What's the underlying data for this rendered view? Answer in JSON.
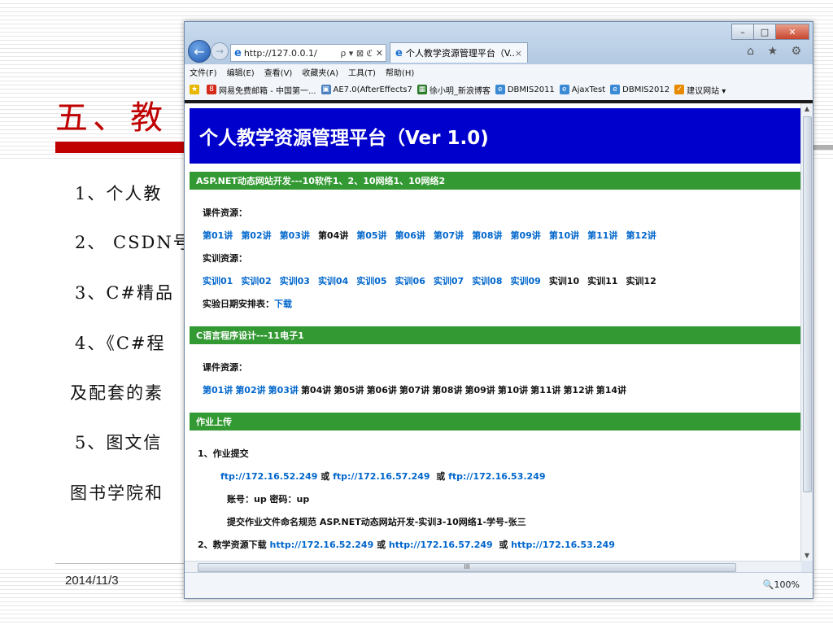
{
  "slide": {
    "title": "五、教",
    "lines": [
      "1、个人教",
      "2、 CSDN号",
      "3、C#精品",
      "4、《C#程",
      "及配套的素",
      "5、图文信",
      "图书学院和"
    ],
    "date": "2014/11/3"
  },
  "browser": {
    "address_url": "http://127.0.0.1/",
    "address_controls": "ρ ▾ ⊠ ℭ ✕",
    "tab_title": "个人教学资源管理平台（V...",
    "tab_close": "×",
    "toolbar_icons": "⌂ ★ ⚙",
    "window_controls": {
      "minimize": "–",
      "maximize": "□",
      "close": "✕"
    },
    "menu": [
      "文件(F)",
      "编辑(E)",
      "查看(V)",
      "收藏夹(A)",
      "工具(T)",
      "帮助(H)"
    ],
    "favorites": [
      "网易免费邮箱 - 中国第一...",
      "AE7.0(AfterEffects7",
      "徐小明_新浪博客",
      "DBMIS2011",
      "AjaxTest",
      "DBMIS2012",
      "建议网站 ▾"
    ],
    "zoom": "🔍100%",
    "hscroll_label": "III"
  },
  "page": {
    "header": "个人教学资源管理平台（Ver 1.0)",
    "section1": {
      "title": "ASP.NET动态网站开发---10软件1、2、10网络1、10网络2",
      "course_label": "课件资源：",
      "lectures": [
        {
          "t": "第01讲",
          "link": true
        },
        {
          "t": "第02讲",
          "link": true
        },
        {
          "t": "第03讲",
          "link": true
        },
        {
          "t": "第04讲",
          "link": false
        },
        {
          "t": "第05讲",
          "link": true
        },
        {
          "t": "第06讲",
          "link": true
        },
        {
          "t": "第07讲",
          "link": true
        },
        {
          "t": "第08讲",
          "link": true
        },
        {
          "t": "第09讲",
          "link": true
        },
        {
          "t": "第10讲",
          "link": true
        },
        {
          "t": "第11讲",
          "link": true
        },
        {
          "t": "第12讲",
          "link": true
        }
      ],
      "training_label": "实训资源：",
      "trainings": [
        {
          "t": "实训01",
          "link": true
        },
        {
          "t": "实训02",
          "link": true
        },
        {
          "t": "实训03",
          "link": true
        },
        {
          "t": "实训04",
          "link": true
        },
        {
          "t": "实训05",
          "link": true
        },
        {
          "t": "实训06",
          "link": true
        },
        {
          "t": "实训07",
          "link": true
        },
        {
          "t": "实训08",
          "link": true
        },
        {
          "t": "实训09",
          "link": true
        },
        {
          "t": "实训10",
          "link": false
        },
        {
          "t": "实训11",
          "link": false
        },
        {
          "t": "实训12",
          "link": false
        }
      ],
      "schedule_label": "实验日期安排表：",
      "schedule_link": "下载"
    },
    "section2": {
      "title": "C语言程序设计---11电子1",
      "course_label": "课件资源：",
      "lectures": [
        {
          "t": "第01讲",
          "link": true
        },
        {
          "t": "第02讲",
          "link": true
        },
        {
          "t": "第03讲",
          "link": true
        },
        {
          "t": "第04讲",
          "link": false
        },
        {
          "t": "第05讲",
          "link": false
        },
        {
          "t": "第06讲",
          "link": false
        },
        {
          "t": "第07讲",
          "link": false
        },
        {
          "t": "第08讲",
          "link": false
        },
        {
          "t": "第09讲",
          "link": false
        },
        {
          "t": "第10讲",
          "link": false
        },
        {
          "t": "第11讲",
          "link": false
        },
        {
          "t": "第12讲",
          "link": false
        },
        {
          "t": "第14讲",
          "link": false
        }
      ]
    },
    "section3": {
      "title": "作业上传",
      "item1": "1、作业提交",
      "ftp1": "ftp://172.16.52.249",
      "or1": "或",
      "ftp2": "ftp://172.16.57.249",
      "or2": "或",
      "ftp3": "ftp://172.16.53.249",
      "account": "账号：up 密码：up",
      "naming": "提交作业文件命名规范 ASP.NET动态网站开发-实训3-10网络1-学号-张三",
      "item2_prefix": "2、教学资源下载",
      "http1": "http://172.16.52.249",
      "or3": "或",
      "http2": "http://172.16.57.249",
      "or4": "或",
      "http3": "http://172.16.53.249"
    }
  }
}
